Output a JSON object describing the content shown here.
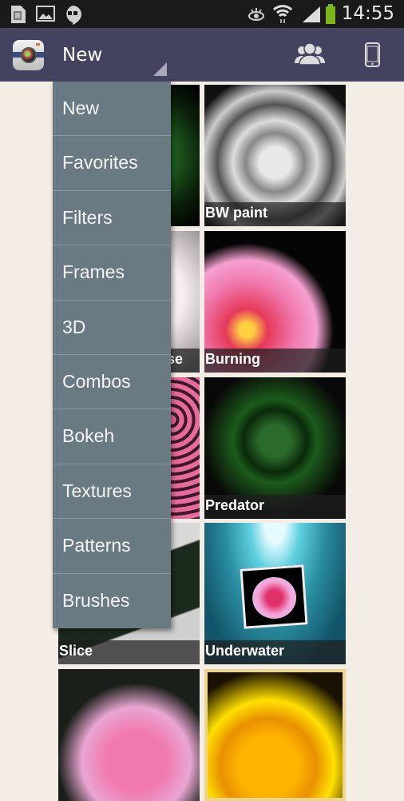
{
  "status_bar": {
    "left_icons": [
      "sim-card-icon",
      "image-icon",
      "hangouts-icon"
    ],
    "right_icons": [
      "eye-icon",
      "wifi-icon",
      "signal-icon",
      "battery-icon"
    ],
    "time": "14:55",
    "battery_color": "#7cb518"
  },
  "action_bar": {
    "app_icon": "camera-app-icon",
    "title": "New",
    "buttons": [
      {
        "name": "community-button",
        "icon": "people-icon"
      },
      {
        "name": "device-button",
        "icon": "phone-icon"
      }
    ],
    "background": "#44435f"
  },
  "dropdown_menu": {
    "items": [
      {
        "label": "New"
      },
      {
        "label": "Favorites"
      },
      {
        "label": "Filters"
      },
      {
        "label": "Frames"
      },
      {
        "label": "3D"
      },
      {
        "label": "Combos"
      },
      {
        "label": "Bokeh"
      },
      {
        "label": "Textures"
      },
      {
        "label": "Patterns"
      },
      {
        "label": "Brushes"
      }
    ]
  },
  "grid": {
    "tiles": [
      {
        "label": "",
        "style": "neon-green"
      },
      {
        "label": "BW paint",
        "style": "bw-paint"
      },
      {
        "label": "se",
        "style": "sketch"
      },
      {
        "label": "Burning",
        "style": "burning"
      },
      {
        "label": "",
        "style": "pattern-roses"
      },
      {
        "label": "Predator",
        "style": "predator"
      },
      {
        "label": "Slice",
        "style": "slice"
      },
      {
        "label": "Underwater",
        "style": "underwater"
      },
      {
        "label": "",
        "style": "soft-pink"
      },
      {
        "label": "",
        "style": "golden"
      }
    ]
  }
}
